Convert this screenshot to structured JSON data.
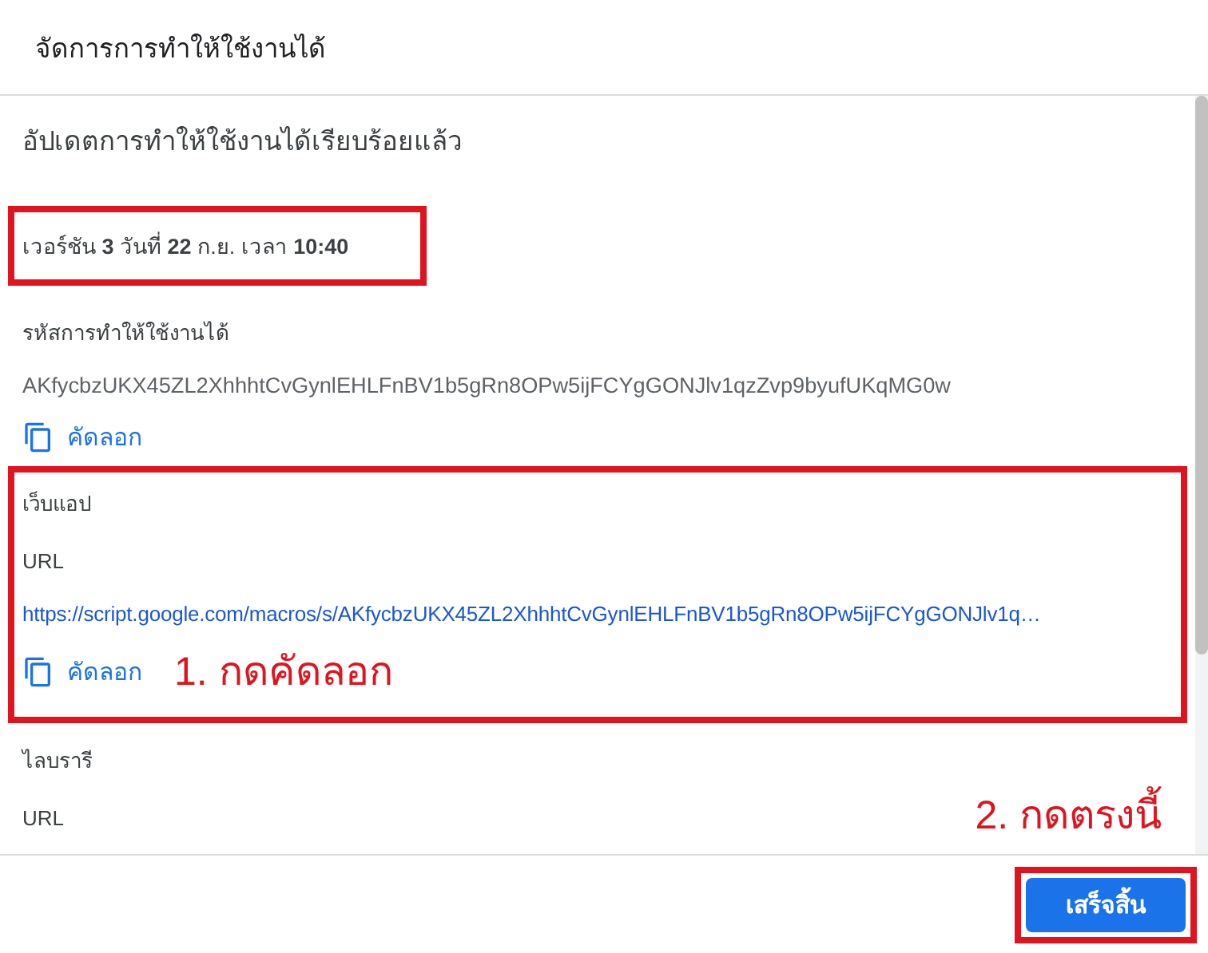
{
  "dialog": {
    "title": "จัดการการทำให้ใช้งานได้"
  },
  "status": "อัปเดตการทำให้ใช้งานได้เรียบร้อยแล้ว",
  "version": {
    "text": "เวอร์ชัน **3** วันที่ **22** ก.ย. เวลา **10:40**",
    "highlighted": true
  },
  "sections": [
    {
      "kind": "id",
      "label": "รหัสการทำให้ใช้งานได้",
      "value": "AKfycbzUKX45ZL2XhhhtCvGynlEHLFnBV1b5gRn8OPw5ijFCYgGONJlv1qzZvp9byufUKqMG0w",
      "copy": "คัดลอก",
      "highlighted": false
    },
    {
      "kind": "webapp",
      "heading": "เว็บแอป",
      "label": "URL",
      "value": "https://script.google.com/macros/s/AKfycbzUKX45ZL2XhhhtCvGynlEHLFnBV1b5gRn8OPw5ijFCYgGONJlv1q…",
      "copy": "คัดลอก",
      "highlighted": true,
      "annotation": "1. กดคัดลอก"
    },
    {
      "kind": "library",
      "heading": "ไลบรารี",
      "label": "URL",
      "highlighted": false
    }
  ],
  "footer": {
    "annotation": "2. กดตรงนี้",
    "button": {
      "label": "เสร็จสิ้น",
      "highlighted": true
    }
  }
}
